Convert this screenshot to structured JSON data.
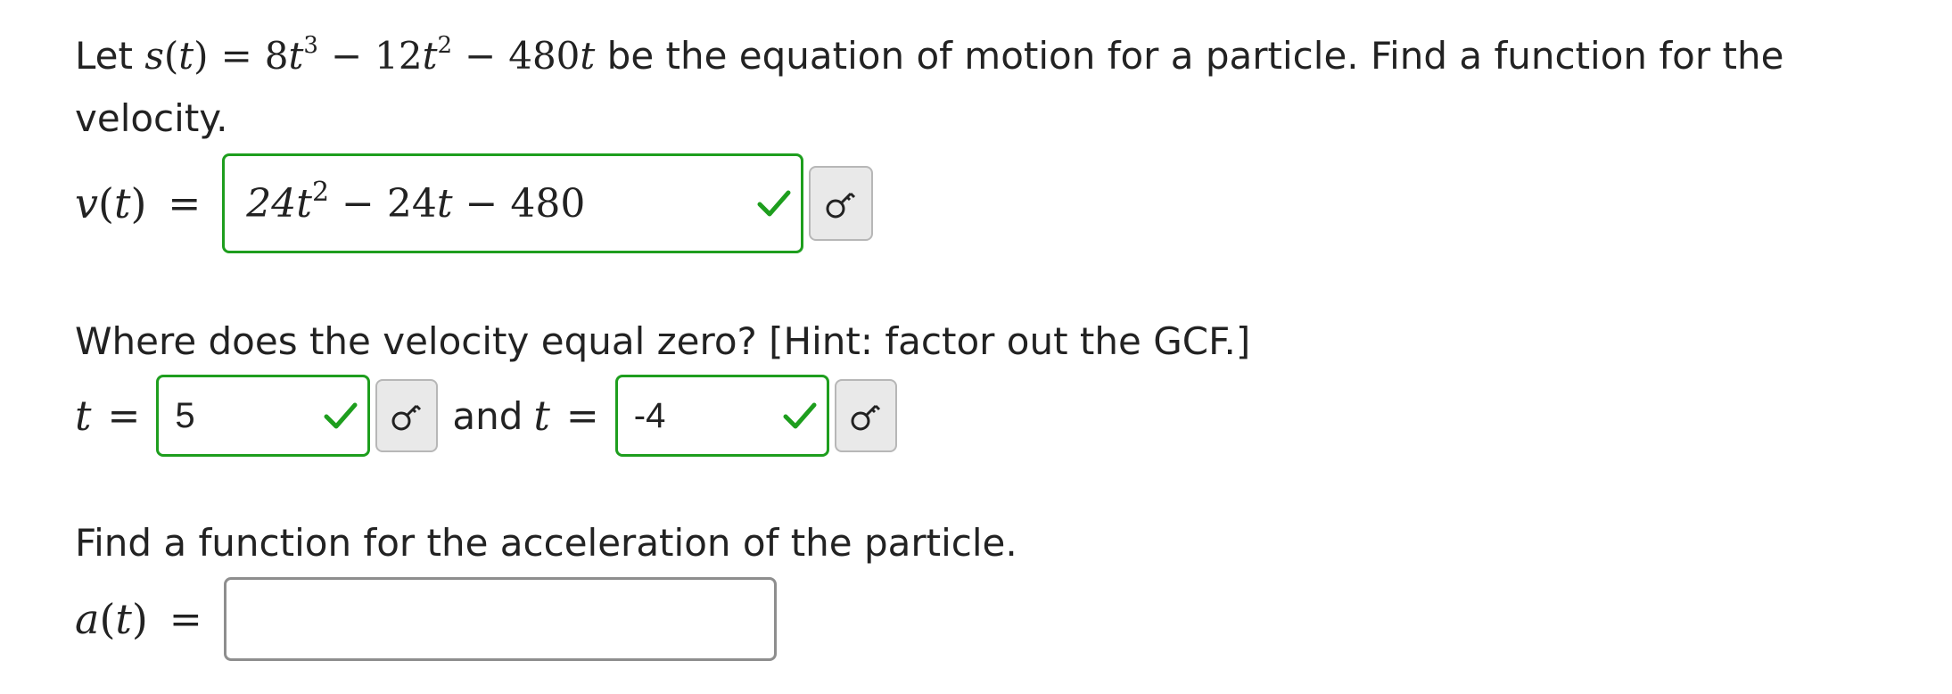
{
  "problem": {
    "intro_prefix": "Let",
    "equation_text": "s(t) = 8t³ − 12t² − 480t",
    "intro_suffix": "be the equation of motion for a particle. Find a function for the",
    "intro_line2": "velocity."
  },
  "velocity": {
    "label": "v(t)",
    "equals": "=",
    "answer_value": "24t² − 24t − 480",
    "status": "correct"
  },
  "zeros": {
    "question": "Where does the velocity equal zero? [Hint: factor out the GCF.]",
    "var_label": "t",
    "equals": "=",
    "answer1_value": "5",
    "connector": "and",
    "answer2_value": "-4",
    "status": "correct"
  },
  "acceleration": {
    "question": "Find a function for the acceleration of the particle.",
    "label": "a(t)",
    "equals": "=",
    "answer_value": ""
  },
  "icons": {
    "check": "check-mark-icon",
    "key": "key-icon"
  },
  "colors": {
    "correct": "#1e9e1e",
    "key_button_bg": "#e9e9e9",
    "empty_border": "#8e8e8e"
  }
}
